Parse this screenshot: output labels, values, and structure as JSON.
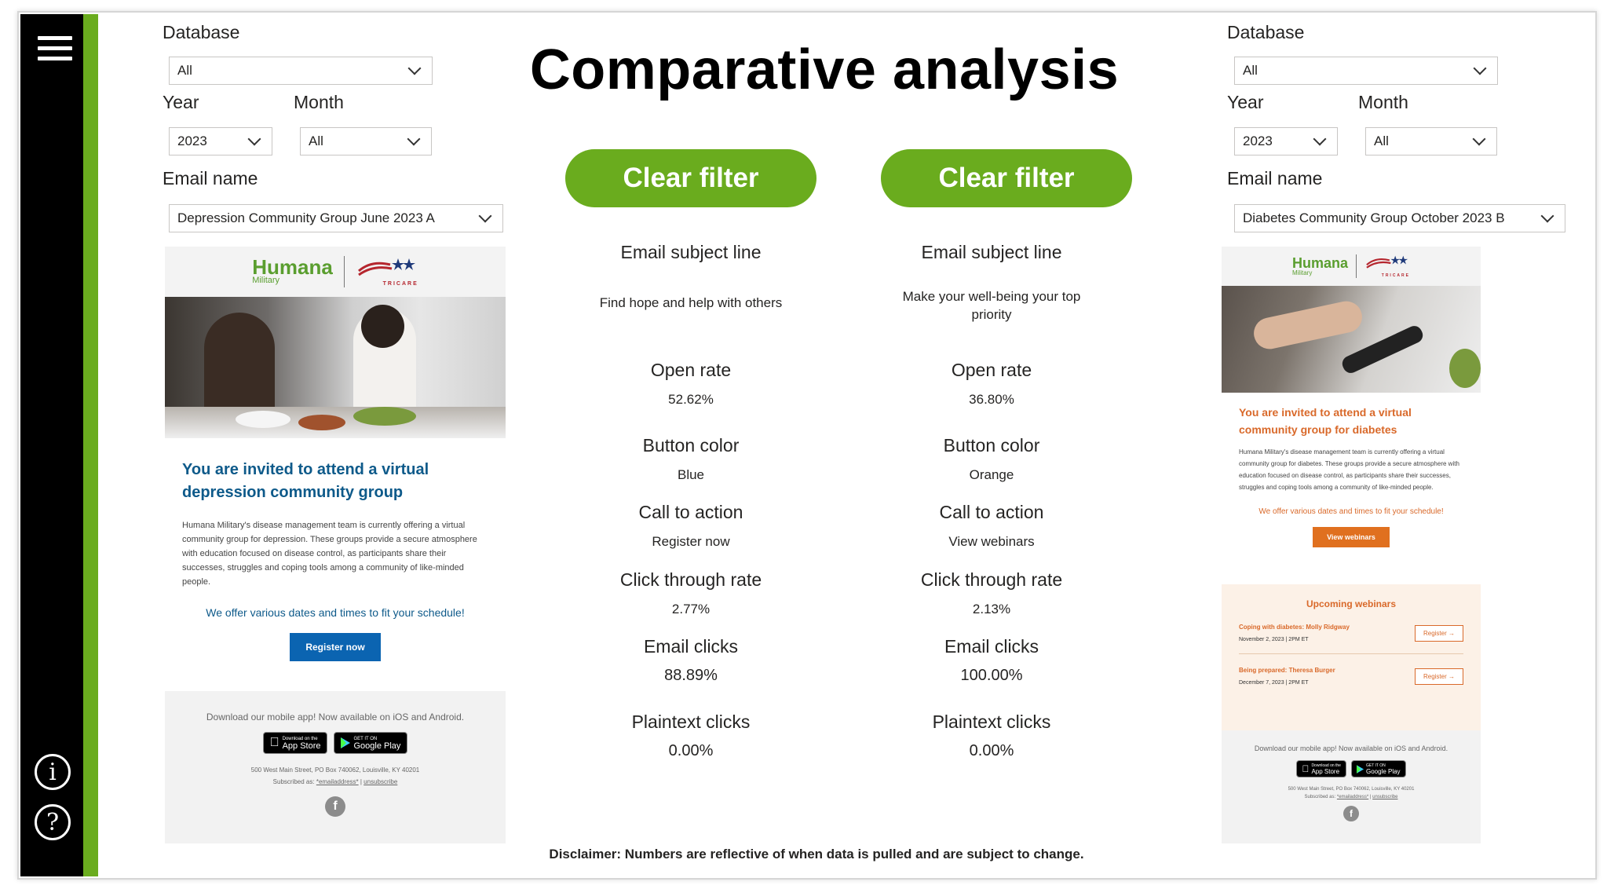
{
  "app": {
    "title": "Comparative analysis",
    "disclaimer": "Disclaimer: Numbers are reflective of when data is pulled and are subject to change."
  },
  "sidebar": {
    "menu_icon": "hamburger-menu-icon",
    "info_icon": "info-icon",
    "help_icon": "help-icon",
    "info_glyph": "i",
    "help_glyph": "?"
  },
  "colors": {
    "accent_green": "#6aac1e",
    "humana_blue": "#0e5a8a",
    "cta_blue": "#0b64b1",
    "cta_orange": "#e0701f",
    "sidebar_black": "#000000"
  },
  "left": {
    "filters": {
      "database_label": "Database",
      "database_value": "All",
      "year_label": "Year",
      "year_value": "2023",
      "month_label": "Month",
      "month_value": "All",
      "email_name_label": "Email name",
      "email_name_value": "Depression Community Group June 2023 A"
    },
    "clear_filter": "Clear filter",
    "metrics": {
      "subject_label": "Email subject line",
      "subject_value": "Find hope and help with others",
      "open_rate_label": "Open rate",
      "open_rate_value": "52.62%",
      "button_color_label": "Button color",
      "button_color_value": "Blue",
      "cta_label": "Call to action",
      "cta_value": "Register now",
      "ctr_label": "Click through rate",
      "ctr_value": "2.77%",
      "email_clicks_label": "Email clicks",
      "email_clicks_value": "88.89%",
      "plaintext_label": "Plaintext clicks",
      "plaintext_value": "0.00%"
    },
    "preview": {
      "brand": "Humana",
      "brand_sub": "Military",
      "tricare": "TRICARE",
      "headline": "You are invited to attend a virtual depression community group",
      "body": "Humana Military's disease management team is currently offering a virtual community group for depression. These groups provide a secure atmosphere with education focused on disease control, as participants share their successes, struggles and coping tools among a community of like-minded people.",
      "schedule": "We offer various dates and times to fit your schedule!",
      "button": "Register now",
      "download": "Download our mobile app! Now available on iOS and Android.",
      "app_store_small": "Download on the",
      "app_store": "App Store",
      "google_small": "GET IT ON",
      "google": "Google Play",
      "address": "500 West Main Street, PO Box 740062, Louisville, KY 40201",
      "subscribed": "Subscribed as:",
      "email_addr": "*emailaddress*",
      "unsubscribe": "unsubscribe",
      "fb": "f"
    }
  },
  "right": {
    "filters": {
      "database_label": "Database",
      "database_value": "All",
      "year_label": "Year",
      "year_value": "2023",
      "month_label": "Month",
      "month_value": "All",
      "email_name_label": "Email name",
      "email_name_value": "Diabetes Community Group October 2023 B"
    },
    "clear_filter": "Clear filter",
    "metrics": {
      "subject_label": "Email subject line",
      "subject_value": "Make your well-being your top priority",
      "open_rate_label": "Open rate",
      "open_rate_value": "36.80%",
      "button_color_label": "Button color",
      "button_color_value": "Orange",
      "cta_label": "Call to action",
      "cta_value": "View webinars",
      "ctr_label": "Click through rate",
      "ctr_value": "2.13%",
      "email_clicks_label": "Email clicks",
      "email_clicks_value": "100.00%",
      "plaintext_label": "Plaintext clicks",
      "plaintext_value": "0.00%"
    },
    "preview": {
      "brand": "Humana",
      "brand_sub": "Military",
      "tricare": "TRICARE",
      "headline": "You are invited to attend a virtual community group for diabetes",
      "body": "Humana Military's disease management team is currently offering a virtual community group for diabetes. These groups provide a secure atmosphere with education focused on disease control, as participants share their successes, struggles and coping tools among a community of like-minded people.",
      "schedule": "We offer various dates and times to fit your schedule!",
      "button": "View webinars",
      "upcoming": "Upcoming webinars",
      "webinars": [
        {
          "title": "Coping with diabetes: Molly Ridgway",
          "date": "November 2, 2023 | 2PM ET",
          "button": "Register"
        },
        {
          "title": "Being prepared: Theresa Burger",
          "date": "December 7, 2023 | 2PM ET",
          "button": "Register"
        }
      ],
      "download": "Download our mobile app! Now available on iOS and Android.",
      "app_store_small": "Download on the",
      "app_store": "App Store",
      "google_small": "GET IT ON",
      "google": "Google Play",
      "address": "500 West Main Street, PO Box 740062, Louisville, KY 40201",
      "subscribed": "Subscribed as:",
      "email_addr": "*emailaddress*",
      "unsubscribe": "unsubscribe",
      "fb": "f"
    }
  }
}
